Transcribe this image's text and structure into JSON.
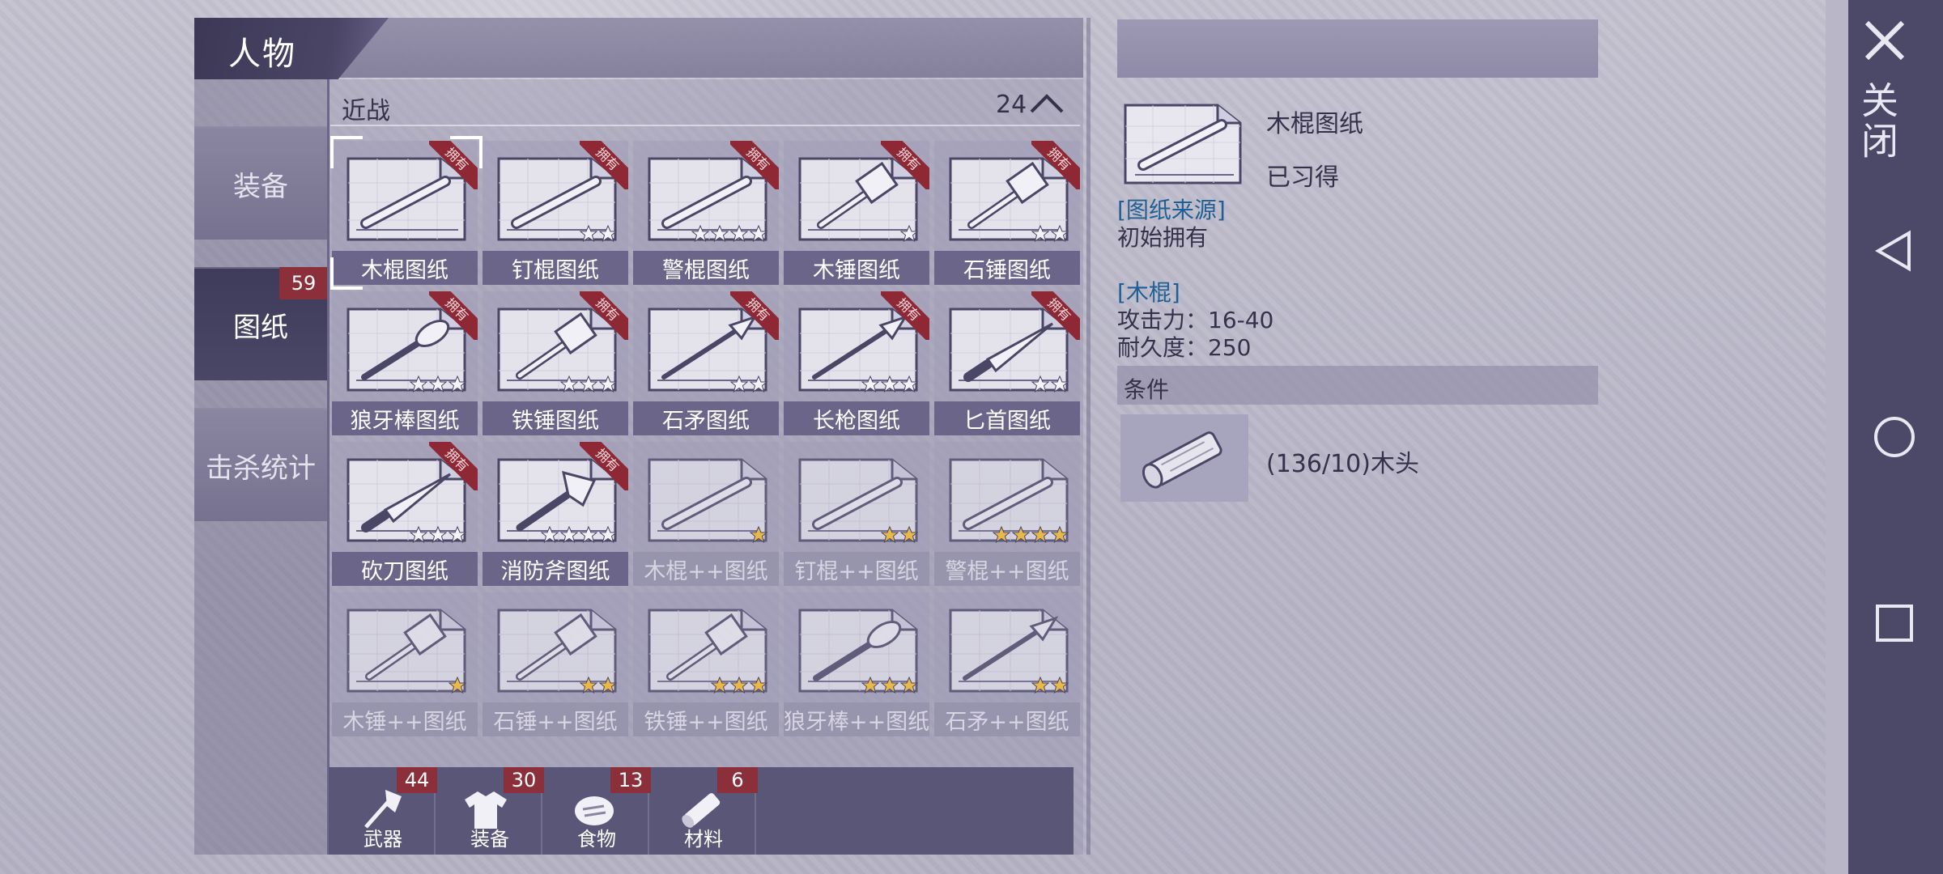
{
  "header": {
    "title": "人物"
  },
  "side_tabs": [
    {
      "label": "装备",
      "active": false
    },
    {
      "label": "图纸",
      "active": true,
      "badge": "59"
    },
    {
      "label": "击杀统计",
      "active": false
    }
  ],
  "category": {
    "label": "近战",
    "count": "24"
  },
  "owned_ribbon": "拥有",
  "items": [
    {
      "label": "木棍图纸",
      "owned": true,
      "stars": 0,
      "icon": "wood-stick-icon"
    },
    {
      "label": "钉棍图纸",
      "owned": true,
      "stars": 2,
      "icon": "nail-club-icon"
    },
    {
      "label": "警棍图纸",
      "owned": true,
      "stars": 4,
      "icon": "baton-icon"
    },
    {
      "label": "木锤图纸",
      "owned": true,
      "stars": 1,
      "icon": "wood-hammer-icon"
    },
    {
      "label": "石锤图纸",
      "owned": true,
      "stars": 2,
      "icon": "stone-hammer-icon"
    },
    {
      "label": "狼牙棒图纸",
      "owned": true,
      "stars": 3,
      "icon": "spiked-mace-icon"
    },
    {
      "label": "铁锤图纸",
      "owned": true,
      "stars": 3,
      "icon": "iron-hammer-icon"
    },
    {
      "label": "石矛图纸",
      "owned": true,
      "stars": 2,
      "icon": "stone-spear-icon"
    },
    {
      "label": "长枪图纸",
      "owned": true,
      "stars": 3,
      "icon": "long-spear-icon"
    },
    {
      "label": "匕首图纸",
      "owned": true,
      "stars": 2,
      "icon": "dagger-icon"
    },
    {
      "label": "砍刀图纸",
      "owned": true,
      "stars": 3,
      "icon": "machete-icon"
    },
    {
      "label": "消防斧图纸",
      "owned": true,
      "stars": 4,
      "icon": "fire-axe-icon"
    },
    {
      "label": "木棍++图纸",
      "owned": false,
      "stars": 1,
      "icon": "wood-stick-plus-icon"
    },
    {
      "label": "钉棍++图纸",
      "owned": false,
      "stars": 2,
      "icon": "nail-club-plus-icon"
    },
    {
      "label": "警棍++图纸",
      "owned": false,
      "stars": 4,
      "icon": "baton-plus-icon"
    },
    {
      "label": "木锤++图纸",
      "owned": false,
      "stars": 1,
      "icon": "wood-hammer-plus-icon"
    },
    {
      "label": "石锤++图纸",
      "owned": false,
      "stars": 2,
      "icon": "stone-hammer-plus-icon"
    },
    {
      "label": "铁锤++图纸",
      "owned": false,
      "stars": 3,
      "icon": "iron-hammer-plus-icon"
    },
    {
      "label": "狼牙棒++图纸",
      "owned": false,
      "stars": 3,
      "icon": "spiked-mace-plus-icon"
    },
    {
      "label": "石矛++图纸",
      "owned": false,
      "stars": 2,
      "icon": "stone-spear-plus-icon"
    }
  ],
  "bottom_tabs": [
    {
      "label": "武器",
      "count": "44",
      "icon": "axe-icon"
    },
    {
      "label": "装备",
      "count": "30",
      "icon": "shirt-icon"
    },
    {
      "label": "食物",
      "count": "13",
      "icon": "meat-icon"
    },
    {
      "label": "材料",
      "count": "6",
      "icon": "log-icon"
    }
  ],
  "detail": {
    "name": "木棍图纸",
    "status": "已习得",
    "source_title": "[图纸来源]",
    "source_text": "初始拥有",
    "weapon_title": "[木棍]",
    "attack": "攻击力：16-40",
    "durability": "耐久度：250",
    "condition_label": "条件",
    "material_text": "(136/10)木头"
  },
  "system": {
    "close_label": "关闭"
  },
  "colors": {
    "accent_dark": "#4c4868",
    "ribbon": "#8e2834",
    "badge": "#8b2f3a",
    "section_blue": "#1f5f93",
    "star_gold": "#e8b84a",
    "star_white": "#f4f3f8"
  }
}
